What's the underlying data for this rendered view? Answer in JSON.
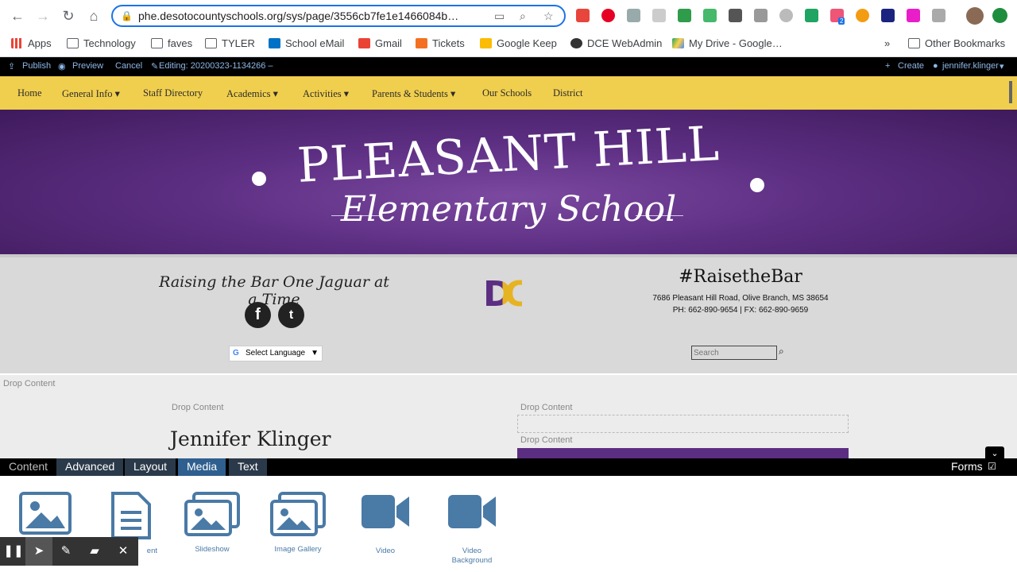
{
  "browser": {
    "url": "phe.desotocountyschools.org/sys/page/3556cb7fe1e1466084b…",
    "bookmarks": [
      "Apps",
      "Technology",
      "faves",
      "TYLER",
      "School eMail",
      "Gmail",
      "Tickets",
      "Google Keep",
      "DCE WebAdmin",
      "My Drive - Google…"
    ],
    "more": "»",
    "other_bookmarks": "Other Bookmarks",
    "ext_badge": "2"
  },
  "cms": {
    "publish": "Publish",
    "preview": "Preview",
    "cancel": "Cancel",
    "editing": "Editing:  20200323-1134266 –",
    "create": "Create",
    "user": "jennifer.klinger"
  },
  "site_nav": [
    "Home",
    "General Info ▾",
    "Staff Directory",
    "Academics ▾",
    "Activities ▾",
    "Parents & Students ▾",
    "Our Schools",
    "District"
  ],
  "banner": {
    "title": "PLEASANT HILL",
    "subtitle": "Elementary School"
  },
  "info": {
    "motto": "Raising the Bar One Jaguar at a Time",
    "hashtag": "#RaisetheBar",
    "address": "7686 Pleasant Hill Road, Olive Branch, MS 38654",
    "phone": "PH: 662-890-9654 | FX: 662-890-9659",
    "language": "Select Language",
    "search_placeholder": "Search",
    "logo_text": "DC"
  },
  "content": {
    "drop": "Drop Content",
    "name": "Jennifer Klinger"
  },
  "editor": {
    "tabs": [
      "Content",
      "Advanced",
      "Layout",
      "Media",
      "Text"
    ],
    "forms": "Forms",
    "tools": [
      "",
      "ent",
      "Slideshow",
      "Image Gallery",
      "Video",
      "Video Background"
    ]
  },
  "colors": {
    "nav_yellow": "#f1cf4e",
    "banner_purple": "#5c2e82",
    "tab_active": "#2f5f8f",
    "tool_blue": "#4a7aa6"
  }
}
